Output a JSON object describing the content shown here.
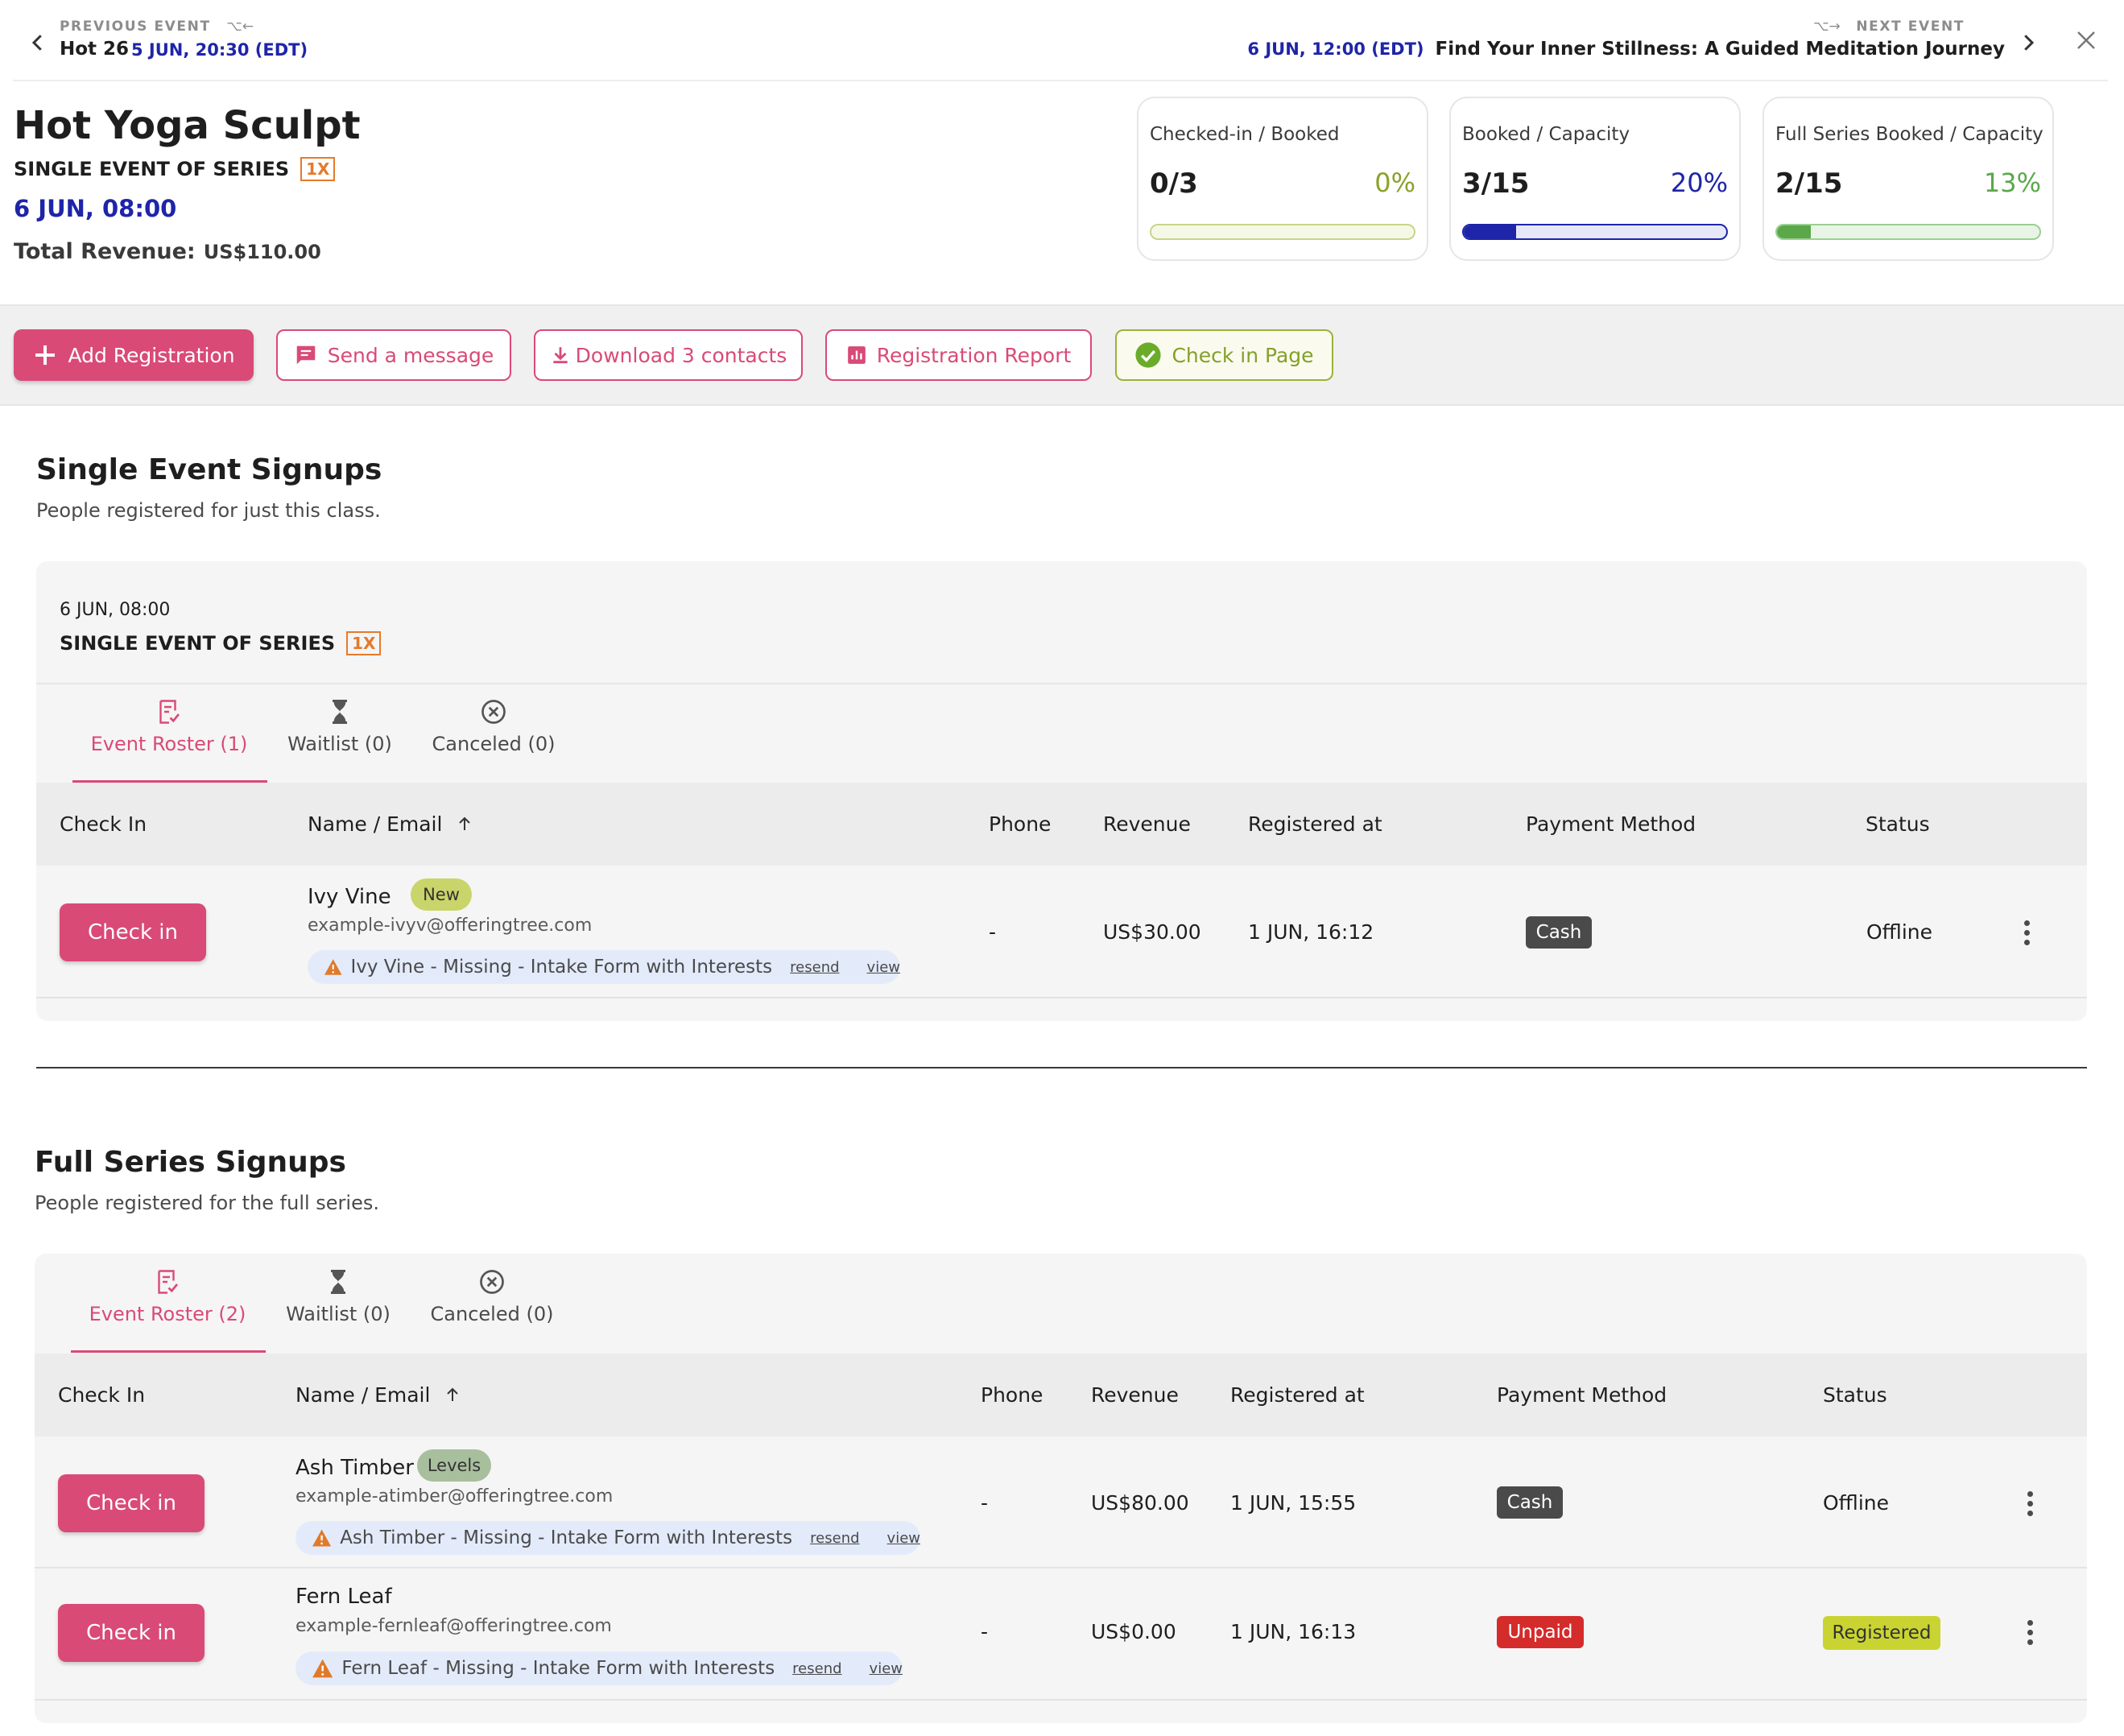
{
  "nav": {
    "previous_label": "PREVIOUS EVENT",
    "previous_shortcut": "⌥←",
    "previous_title": "Hot 26",
    "previous_date": "5 JUN, 20:30 (EDT)",
    "next_label": "NEXT EVENT",
    "next_shortcut": "⌥→",
    "next_date": "6 JUN, 12:00 (EDT)",
    "next_title": "Find Your Inner Stillness: A Guided Meditation Journey"
  },
  "event": {
    "title": "Hot Yoga Sculpt",
    "series_label": "SINGLE EVENT OF SERIES",
    "series_badge": "1X",
    "date": "6 JUN, 08:00",
    "revenue_label": "Total Revenue:",
    "revenue_value": "US$110.00"
  },
  "stats": [
    {
      "label": "Checked-in / Booked",
      "value": "0/3",
      "percent": "0%",
      "fraction": 0.0,
      "color": "#8aa22a",
      "track": "#f6f8e6",
      "border": "#c8d48a"
    },
    {
      "label": "Booked / Capacity",
      "value": "3/15",
      "percent": "20%",
      "fraction": 0.2,
      "color": "#1e25a8",
      "track": "#e6e8f8",
      "border": "#1e25a8"
    },
    {
      "label": "Full Series Booked / Capacity",
      "value": "2/15",
      "percent": "13%",
      "fraction": 0.13,
      "color": "#5aa84a",
      "track": "#e8f5e6",
      "border": "#9ccf92"
    }
  ],
  "toolbar": {
    "add_registration": "Add Registration",
    "send_message": "Send a message",
    "download_contacts": "Download 3 contacts",
    "registration_report": "Registration Report",
    "check_in_page": "Check in Page"
  },
  "single": {
    "title": "Single Event Signups",
    "subtitle": "People registered for just this class.",
    "panel_date": "6 JUN, 08:00",
    "panel_series": "SINGLE EVENT OF SERIES",
    "panel_badge": "1X",
    "tabs": [
      "Event Roster (1)",
      "Waitlist (0)",
      "Canceled (0)"
    ],
    "columns": [
      "Check In",
      "Name / Email",
      "Phone",
      "Revenue",
      "Registered at",
      "Payment Method",
      "Status"
    ],
    "rows": [
      {
        "check_in": "Check in",
        "name": "Ivy Vine",
        "tag": "New",
        "email": "example-ivyv@offeringtree.com",
        "warning": "Ivy Vine - Missing - Intake Form with Interests",
        "resend": "resend",
        "view": "view",
        "phone": "-",
        "revenue": "US$30.00",
        "registered_at": "1 JUN, 16:12",
        "payment": "Cash",
        "status": "Offline"
      }
    ]
  },
  "full": {
    "title": "Full Series Signups",
    "subtitle": "People registered for the full series.",
    "tabs": [
      "Event Roster (2)",
      "Waitlist (0)",
      "Canceled (0)"
    ],
    "columns": [
      "Check In",
      "Name / Email",
      "Phone",
      "Revenue",
      "Registered at",
      "Payment Method",
      "Status"
    ],
    "rows": [
      {
        "check_in": "Check in",
        "name": "Ash Timber",
        "tag": "Levels",
        "email": "example-atimber@offeringtree.com",
        "warning": "Ash Timber - Missing - Intake Form with Interests",
        "resend": "resend",
        "view": "view",
        "phone": "-",
        "revenue": "US$80.00",
        "registered_at": "1 JUN, 15:55",
        "payment": "Cash",
        "status": "Offline"
      },
      {
        "check_in": "Check in",
        "name": "Fern Leaf",
        "email": "example-fernleaf@offeringtree.com",
        "warning": "Fern Leaf - Missing - Intake Form with Interests",
        "resend": "resend",
        "view": "view",
        "phone": "-",
        "revenue": "US$0.00",
        "registered_at": "1 JUN, 16:13",
        "payment": "Unpaid",
        "status": "Registered"
      }
    ]
  }
}
